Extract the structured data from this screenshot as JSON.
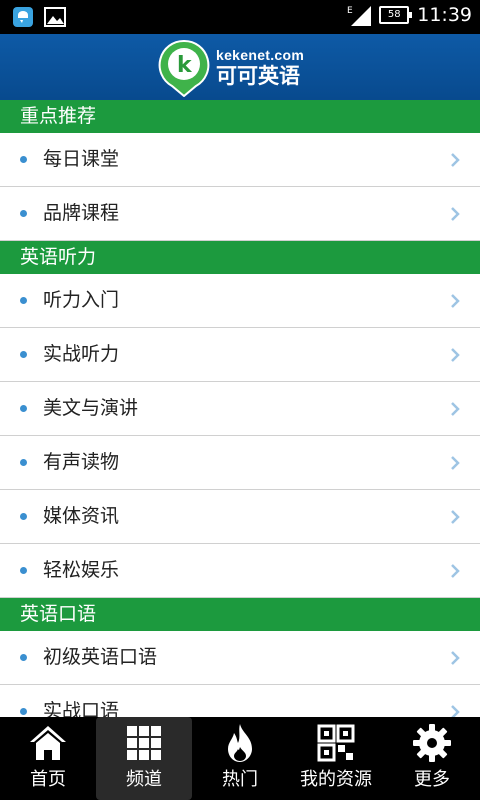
{
  "status_bar": {
    "battery": "58",
    "time": "11:39",
    "icons": [
      "chat-notification-icon",
      "image-notification-icon",
      "signal-icon",
      "battery-icon"
    ]
  },
  "header": {
    "domain": "kekenet.com",
    "brand": "可可英语",
    "logo_letter": "k"
  },
  "sections": [
    {
      "title": "重点推荐",
      "items": [
        "每日课堂",
        "品牌课程"
      ]
    },
    {
      "title": "英语听力",
      "items": [
        "听力入门",
        "实战听力",
        "美文与演讲",
        "有声读物",
        "媒体资讯",
        "轻松娱乐"
      ]
    },
    {
      "title": "英语口语",
      "items": [
        "初级英语口语",
        "实战口语"
      ]
    }
  ],
  "bottom_nav": [
    {
      "label": "首页",
      "icon": "home-icon"
    },
    {
      "label": "频道",
      "icon": "grid-icon",
      "active": true
    },
    {
      "label": "热门",
      "icon": "flame-icon"
    },
    {
      "label": "我的资源",
      "icon": "qr-icon"
    },
    {
      "label": "更多",
      "icon": "gear-icon"
    }
  ],
  "colors": {
    "header_blue": "#0a4f98",
    "section_green": "#1c9a3e",
    "bullet_blue": "#3a8fd0",
    "chevron": "#9ec4e4"
  }
}
